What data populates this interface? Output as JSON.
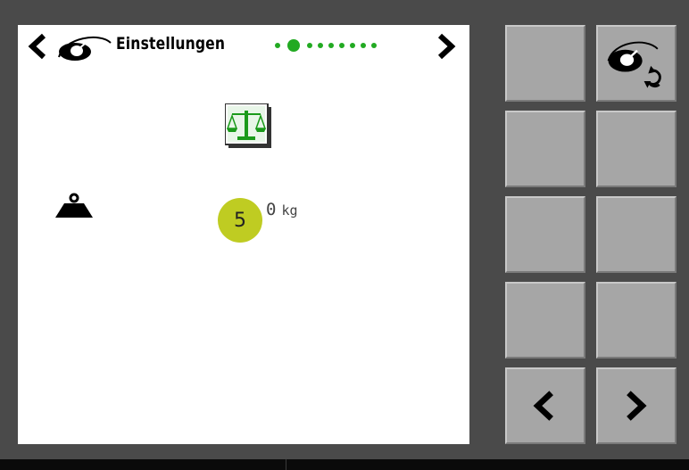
{
  "header": {
    "title": "Einstellungen",
    "page_dots_count": 9,
    "active_dot_index": 1
  },
  "content": {
    "badge_number": "5",
    "weight_value": "0",
    "weight_unit": "kg"
  },
  "softkeys": [
    {
      "name": "softkey-1-1",
      "icon": ""
    },
    {
      "name": "softkey-1-2",
      "icon": "tractor-view-refresh-icon"
    },
    {
      "name": "softkey-2-1",
      "icon": ""
    },
    {
      "name": "softkey-2-2",
      "icon": ""
    },
    {
      "name": "softkey-3-1",
      "icon": ""
    },
    {
      "name": "softkey-3-2",
      "icon": ""
    },
    {
      "name": "softkey-4-1",
      "icon": ""
    },
    {
      "name": "softkey-4-2",
      "icon": ""
    },
    {
      "name": "softkey-5-1",
      "icon": "chevron-left-icon"
    },
    {
      "name": "softkey-5-2",
      "icon": "chevron-right-icon"
    }
  ],
  "colors": {
    "background": "#4a4a4a",
    "panel": "#ffffff",
    "softkey": "#a6a6a6",
    "accent_green": "#22aa22",
    "badge": "#bfcc22"
  }
}
